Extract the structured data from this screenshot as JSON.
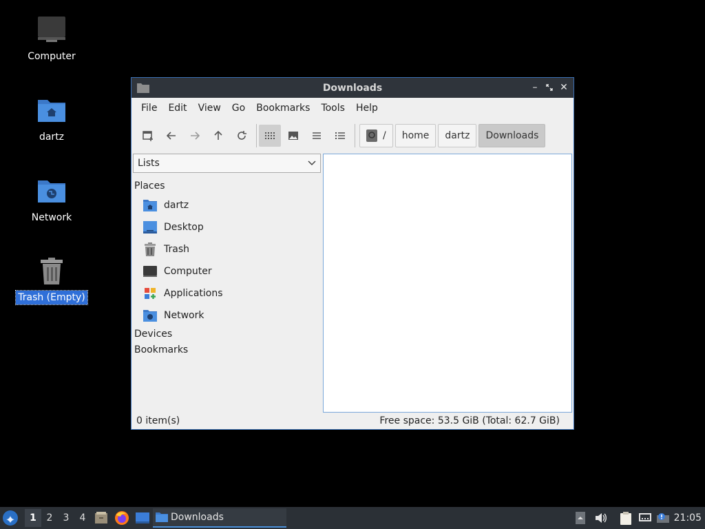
{
  "desktop": {
    "icons": [
      {
        "label": "Computer"
      },
      {
        "label": "dartz"
      },
      {
        "label": "Network"
      },
      {
        "label": "Trash (Empty)"
      }
    ]
  },
  "window": {
    "title": "Downloads",
    "menu": [
      "File",
      "Edit",
      "View",
      "Go",
      "Bookmarks",
      "Tools",
      "Help"
    ],
    "breadcrumbs": [
      "/",
      "home",
      "dartz",
      "Downloads"
    ],
    "sidebar": {
      "selector": "Lists",
      "sections": {
        "places": "Places",
        "devices": "Devices",
        "bookmarks": "Bookmarks"
      },
      "places": [
        "dartz",
        "Desktop",
        "Trash",
        "Computer",
        "Applications",
        "Network"
      ]
    },
    "status": {
      "items": "0 item(s)",
      "free_space": "Free space: 53.5 GiB (Total: 62.7 GiB)"
    }
  },
  "taskbar": {
    "workspaces": [
      "1",
      "2",
      "3",
      "4"
    ],
    "task_label": "Downloads",
    "clock": "21:05"
  },
  "colors": {
    "accent": "#2f6fd8",
    "folder": "#4a8fe0",
    "titlebar": "#2f343b"
  }
}
